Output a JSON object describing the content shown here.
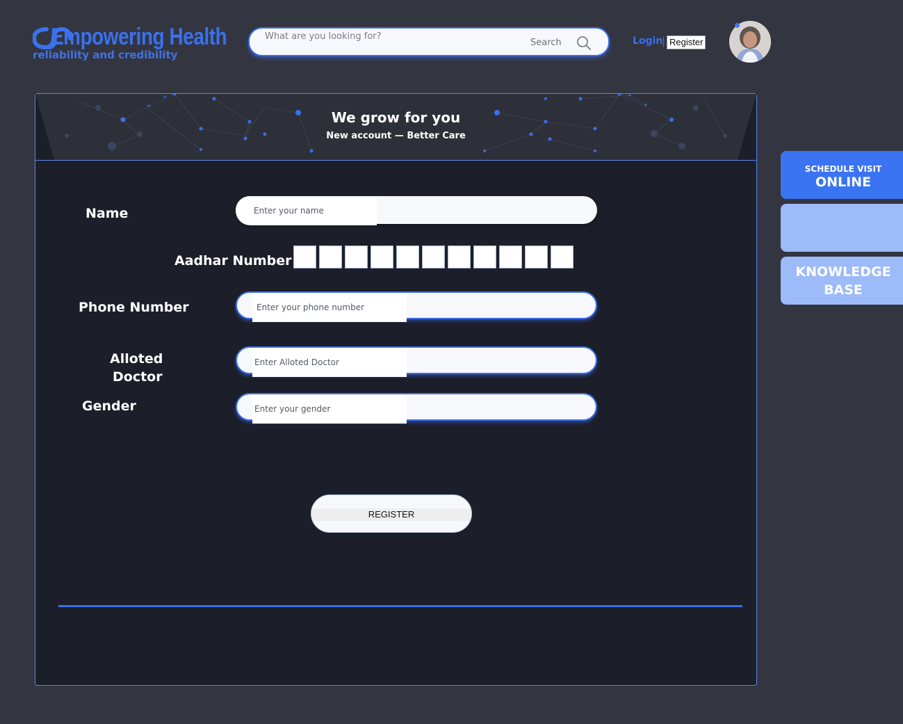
{
  "header": {
    "logo_title": "Empowering Health",
    "logo_tagline": "reliability and credibility",
    "search": {
      "placeholder": "What are you looking for?",
      "button_label": "Search"
    },
    "auth": {
      "login_label": "Login",
      "separator": "|",
      "register_label": "Register"
    }
  },
  "banner": {
    "title": "We grow for you",
    "subtitle": "New account — Better Care"
  },
  "form": {
    "name": {
      "label": "Name",
      "placeholder": "Enter your name"
    },
    "aadhar": {
      "label": "Aadhar Number",
      "box_count": 11
    },
    "phone": {
      "label": "Phone Number",
      "placeholder": "Enter your phone number"
    },
    "doctor": {
      "label_line1": "Alloted",
      "label_line2": "Doctor",
      "placeholder": "Enter Alloted Doctor"
    },
    "gender": {
      "label": "Gender",
      "placeholder": "Enter your gender"
    },
    "submit_label": "REGISTER"
  },
  "side_tabs": {
    "schedule": {
      "small": "SCHEDULE VISIT",
      "big": "ONLINE"
    },
    "knowledge": {
      "line1": "KNOWLEDGE",
      "line2": "BASE"
    }
  },
  "colors": {
    "accent": "#3a6fee",
    "page_bg": "#333640",
    "card_bg": "#1c1f29",
    "tab_light": "#9dbaf9"
  },
  "icons": {
    "search": "search-icon",
    "logo": "logo-mark-icon"
  }
}
